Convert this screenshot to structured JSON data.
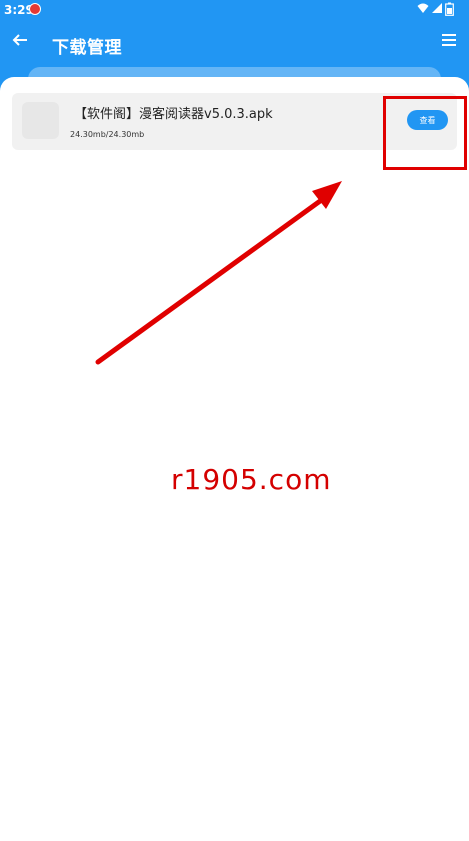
{
  "status_bar": {
    "time": "3:29"
  },
  "header": {
    "title": "下载管理"
  },
  "downloads": [
    {
      "name": "【软件阁】漫客阅读器v5.0.3.apk",
      "size": "24.30mb/24.30mb",
      "action_label": "查看"
    }
  ],
  "watermark": "r1905.com",
  "colors": {
    "primary": "#2196f3",
    "annotation": "#e00000"
  },
  "icons": {
    "back": "arrow-left-icon",
    "menu": "menu-icon",
    "wifi": "wifi-icon",
    "signal": "signal-icon",
    "battery": "battery-icon"
  }
}
